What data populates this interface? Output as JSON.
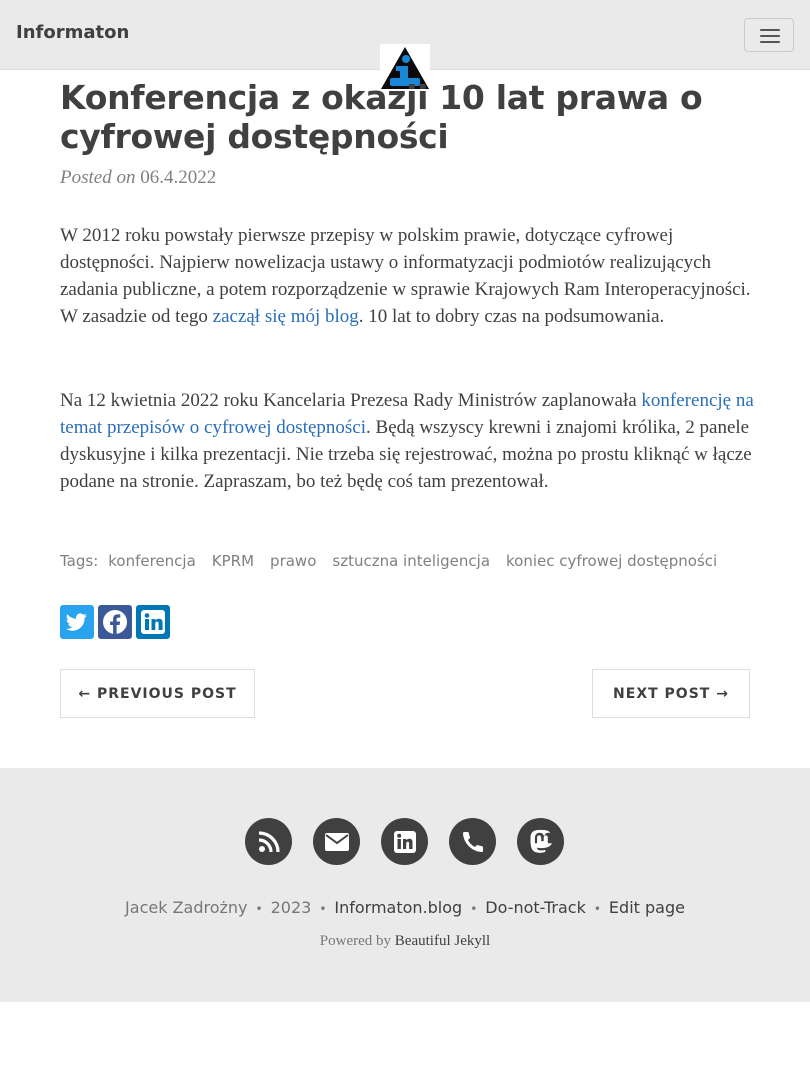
{
  "navbar": {
    "brand": "Informaton",
    "menu_icon": "hamburger-menu-icon"
  },
  "avatar": {
    "icon": "info-logo"
  },
  "post": {
    "title": "Konferencja z okazji 10 lat prawa o cyfrowej dostępności",
    "meta_prefix": "Posted on",
    "date": "06.4.2022",
    "paragraph1": {
      "before": "W 2012 roku powstały pierwsze przepisy w polskim prawie, dotyczące cyfrowej dostępności. Najpierw nowelizacja ustawy o informatyzacji podmiotów realizujących zadania publiczne, a potem rozporządzenie w sprawie Krajowych Ram Interoperacyjności. W zasadzie od tego ",
      "link": "zaczął się mój blog",
      "after": ". 10 lat to dobry czas na podsumowania."
    },
    "paragraph2": {
      "before": "Na 12 kwietnia 2022 roku Kancelaria Prezesa Rady Ministrów zaplanowała ",
      "link": "konferencję na temat przepisów o cyfrowej dostępności",
      "after": ". Będą wszyscy krewni i znajomi królika, 2 panele dyskusyjne i kilka prezentacji. Nie trzeba się rejestrować, można po prostu kliknąć w łącze podane na stronie. Zapraszam, bo też będę coś tam prezentował."
    },
    "tags_label": "Tags:",
    "tags": [
      "konferencja",
      "KPRM",
      "prawo",
      "sztuczna inteligencja",
      "koniec cyfrowej dostępności"
    ]
  },
  "share": {
    "icons": [
      "twitter-icon",
      "facebook-icon",
      "linkedin-icon"
    ],
    "colors": [
      "#2aa3ef",
      "#3b5998",
      "#0077b5"
    ]
  },
  "pager": {
    "previous": "← PREVIOUS POST",
    "next": "NEXT POST →"
  },
  "footer": {
    "social_icons": [
      "rss-icon",
      "envelope-icon",
      "linkedin-icon",
      "phone-icon",
      "mastodon-icon"
    ],
    "author": "Jacek Zadrożny",
    "year": "2023",
    "site": "Informaton.blog",
    "dnt": "Do-not-Track",
    "edit": "Edit page",
    "powered_prefix": "Powered by",
    "powered_link": "Beautiful Jekyll",
    "separator": "•"
  },
  "colors": {
    "link": "#2a6ebb",
    "text": "#404040",
    "navbar_bg": "#eaeaea",
    "footer_bg": "#eaeaea"
  }
}
